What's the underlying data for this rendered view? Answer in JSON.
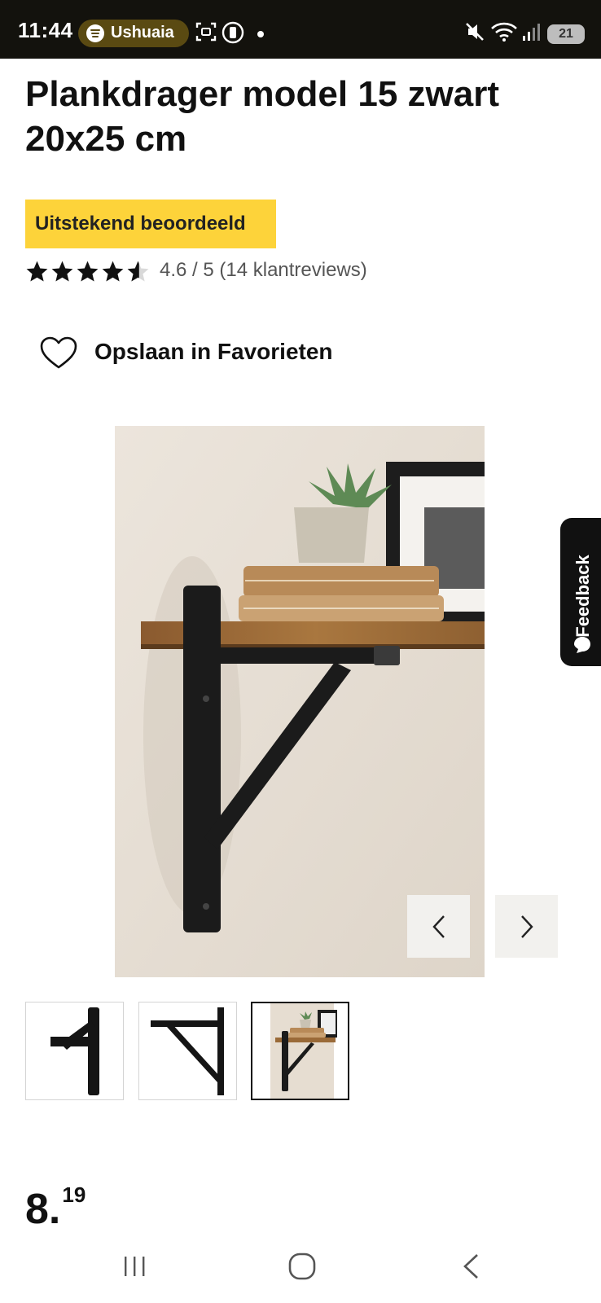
{
  "status_bar": {
    "time": "11:44",
    "media_app": "Ushuaia",
    "battery": "21",
    "icons": [
      "spotify-icon",
      "screenshot-icon",
      "sim-icon",
      "mute-icon",
      "wifi-icon",
      "signal-icon",
      "battery-icon"
    ]
  },
  "product": {
    "title": "Plankdrager model 15 zwart 20x25 cm",
    "badge": "Uitstekend beoordeeld",
    "rating_value": 4.6,
    "rating_text": "4.6 / 5 (14 klantreviews)",
    "favorite_label": "Opslaan in Favorieten",
    "price_int": "8",
    "price_dec": "19",
    "badge_color": "#fdd33a"
  },
  "gallery": {
    "thumbnails": [
      "bracket-front",
      "bracket-side",
      "shelf-lifestyle"
    ],
    "active_index": 2
  },
  "feedback": {
    "label": "Feedback"
  },
  "nav_bar": {
    "icons": [
      "recents-icon",
      "home-icon",
      "back-icon"
    ]
  }
}
